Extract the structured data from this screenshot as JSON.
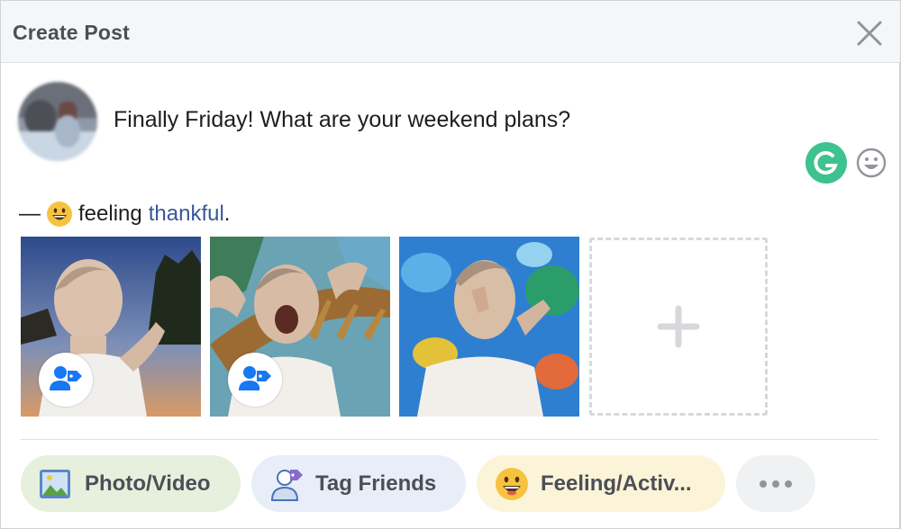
{
  "header": {
    "title": "Create Post",
    "close_icon": "close-icon"
  },
  "composer": {
    "text": "Finally Friday! What are your weekend plans?",
    "grammarly_icon": "grammarly-icon",
    "emoji_icon": "emoji-smile-icon"
  },
  "feeling": {
    "prefix": "—",
    "verb": "feeling",
    "value": "thankful",
    "suffix": "."
  },
  "photos": [
    {
      "name": "photo-1",
      "tag_icon": "tag-person-icon"
    },
    {
      "name": "photo-2",
      "tag_icon": "tag-person-icon"
    },
    {
      "name": "photo-3"
    }
  ],
  "add_photo_icon": "plus-icon",
  "actions": [
    {
      "label": "Photo/Video",
      "icon": "photo-icon",
      "bg": "#e6f0dd"
    },
    {
      "label": "Tag Friends",
      "icon": "tag-friends-icon",
      "bg": "#e7eef8"
    },
    {
      "label": "Feeling/Activ...",
      "icon": "feeling-icon",
      "bg": "#fcf4d9"
    },
    {
      "label": "",
      "icon": "more-icon",
      "bg": "#f0f1f3"
    }
  ],
  "colors": {
    "link": "#385898",
    "grammarly": "#3ec28f",
    "header_bg": "#f5f6f7"
  }
}
